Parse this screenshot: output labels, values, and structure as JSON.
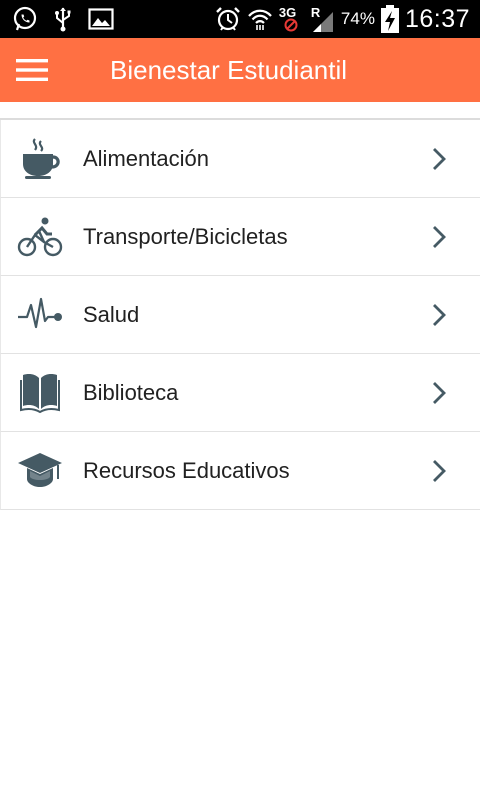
{
  "status_bar": {
    "left_icons": [
      "whatsapp-icon",
      "usb-icon",
      "image-icon"
    ],
    "right_icons": [
      "alarm-icon",
      "wifi-icon",
      "mobile-data-icon",
      "signal-icon",
      "battery-charging-icon"
    ],
    "network_type": "3G",
    "roaming": "R",
    "battery": "74%",
    "time": "16:37"
  },
  "app_bar": {
    "title": "Bienestar Estudiantil",
    "menu_icon": "hamburger-menu-icon",
    "color": "#ff7043"
  },
  "menu": {
    "items": [
      {
        "label": "Alimentación",
        "icon": "coffee-cup-icon"
      },
      {
        "label": "Transporte/Bicicletas",
        "icon": "bicycle-icon"
      },
      {
        "label": "Salud",
        "icon": "heartbeat-icon"
      },
      {
        "label": "Biblioteca",
        "icon": "book-icon"
      },
      {
        "label": "Recursos Educativos",
        "icon": "graduation-cap-icon"
      }
    ],
    "chevron_icon": "chevron-right-icon",
    "icon_color": "#455a64"
  }
}
